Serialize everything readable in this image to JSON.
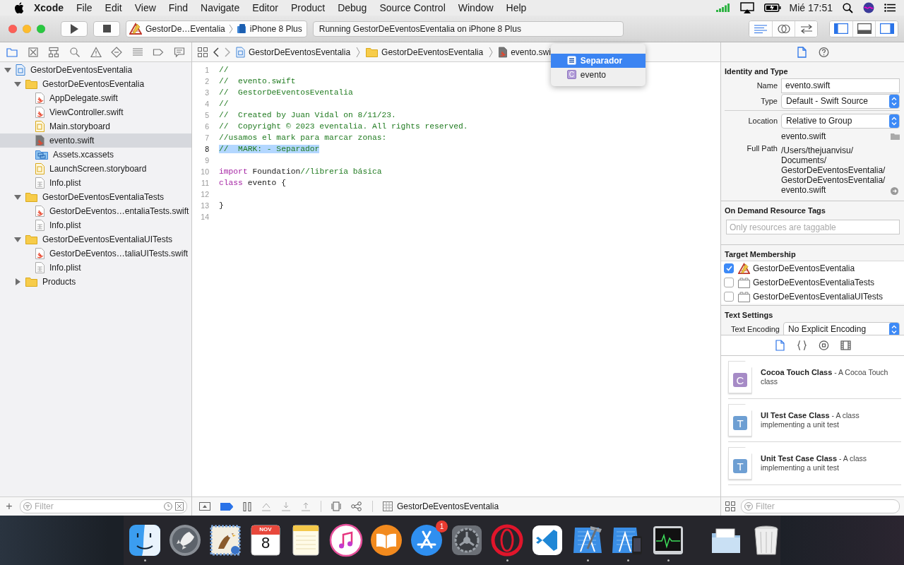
{
  "menu_bar": {
    "app": "Xcode",
    "menus": [
      "File",
      "Edit",
      "View",
      "Find",
      "Navigate",
      "Editor",
      "Product",
      "Debug",
      "Source Control",
      "Window",
      "Help"
    ],
    "clock": "Mié 17:51"
  },
  "toolbar": {
    "scheme": "GestorDe…Eventalia",
    "device": "iPhone 8 Plus",
    "activity": "Running GestorDeEventosEventalia on iPhone 8 Plus",
    "editor_modes": [
      {
        "kind": "standard",
        "selected": true
      },
      {
        "kind": "assistant",
        "selected": false
      },
      {
        "kind": "version",
        "selected": false
      }
    ],
    "panels": [
      {
        "kind": "navigator",
        "on": true
      },
      {
        "kind": "debug",
        "on": false
      },
      {
        "kind": "inspector",
        "on": true
      }
    ]
  },
  "navigator": {
    "tabs": [
      {
        "kind": "project",
        "selected": true
      },
      {
        "kind": "source-control",
        "selected": false
      },
      {
        "kind": "symbol",
        "selected": false
      },
      {
        "kind": "find",
        "selected": false
      },
      {
        "kind": "issue",
        "selected": false
      },
      {
        "kind": "test",
        "selected": false
      },
      {
        "kind": "debug",
        "selected": false
      },
      {
        "kind": "breakpoint",
        "selected": false
      },
      {
        "kind": "report",
        "selected": false
      }
    ],
    "tree": [
      {
        "name": "GestorDeEventosEventalia",
        "kind": "project",
        "expanded": true,
        "selected": false,
        "children": [
          {
            "name": "GestorDeEventosEventalia",
            "kind": "folder",
            "expanded": true,
            "selected": false,
            "children": [
              {
                "name": "AppDelegate.swift",
                "kind": "swift",
                "selected": false
              },
              {
                "name": "ViewController.swift",
                "kind": "swift",
                "selected": false
              },
              {
                "name": "Main.storyboard",
                "kind": "storyboard",
                "selected": false
              },
              {
                "name": "evento.swift",
                "kind": "swift",
                "selected": true
              },
              {
                "name": "Assets.xcassets",
                "kind": "assets",
                "selected": false
              },
              {
                "name": "LaunchScreen.storyboard",
                "kind": "storyboard",
                "selected": false
              },
              {
                "name": "Info.plist",
                "kind": "plist",
                "selected": false
              }
            ]
          },
          {
            "name": "GestorDeEventosEventaliaTests",
            "kind": "folder",
            "expanded": true,
            "selected": false,
            "children": [
              {
                "name": "GestorDeEventos…entaliaTests.swift",
                "kind": "swift",
                "selected": false
              },
              {
                "name": "Info.plist",
                "kind": "plist",
                "selected": false
              }
            ]
          },
          {
            "name": "GestorDeEventosEventaliaUITests",
            "kind": "folder",
            "expanded": true,
            "selected": false,
            "children": [
              {
                "name": "GestorDeEventos…taliaUITests.swift",
                "kind": "swift",
                "selected": false
              },
              {
                "name": "Info.plist",
                "kind": "plist",
                "selected": false
              }
            ]
          },
          {
            "name": "Products",
            "kind": "folder",
            "expanded": false,
            "selected": false
          }
        ]
      }
    ],
    "add_label": "+",
    "filter": {
      "placeholder": "Filter"
    }
  },
  "editor": {
    "crumbs": [
      {
        "kind": "project",
        "text": "GestorDeEventosEventalia"
      },
      {
        "kind": "folder",
        "text": "GestorDeEventosEventalia"
      },
      {
        "kind": "swift",
        "text": "evento.swi"
      }
    ],
    "symbol_menu": [
      {
        "kind": "mark",
        "text": "Separador",
        "selected": true
      },
      {
        "kind": "class",
        "icon_letter": "C",
        "text": "evento",
        "selected": false
      }
    ],
    "lines": [
      {
        "number": "1",
        "highlighted": false,
        "tokens": [
          {
            "kind": "comment",
            "text": "//"
          }
        ]
      },
      {
        "number": "2",
        "highlighted": false,
        "tokens": [
          {
            "kind": "comment",
            "text": "//  evento.swift"
          }
        ]
      },
      {
        "number": "3",
        "highlighted": false,
        "tokens": [
          {
            "kind": "comment",
            "text": "//  GestorDeEventosEventalia"
          }
        ]
      },
      {
        "number": "4",
        "highlighted": false,
        "tokens": [
          {
            "kind": "comment",
            "text": "//"
          }
        ]
      },
      {
        "number": "5",
        "highlighted": false,
        "tokens": [
          {
            "kind": "comment",
            "text": "//  Created by Juan Vidal on 8/11/23."
          }
        ]
      },
      {
        "number": "6",
        "highlighted": false,
        "tokens": [
          {
            "kind": "comment",
            "text": "//  Copyright © 2023 eventalia. All rights reserved."
          }
        ]
      },
      {
        "number": "7",
        "highlighted": false,
        "tokens": [
          {
            "kind": "comment",
            "text": "//usamos el mark para marcar zonas:"
          }
        ]
      },
      {
        "number": "8",
        "highlighted": true,
        "tokens": [
          {
            "kind": "comment",
            "text": "//  MARK: - Separador"
          }
        ]
      },
      {
        "number": "9",
        "highlighted": false
      },
      {
        "number": "10",
        "highlighted": false,
        "tokens": [
          {
            "kind": "keyword",
            "text": "import"
          },
          {
            "kind": "plain",
            "text": " Foundation"
          },
          {
            "kind": "comment",
            "text": "//librería básica"
          }
        ]
      },
      {
        "number": "11",
        "highlighted": false,
        "tokens": [
          {
            "kind": "keyword",
            "text": "class"
          },
          {
            "kind": "plain",
            "text": " evento {"
          }
        ]
      },
      {
        "number": "12",
        "highlighted": false
      },
      {
        "number": "13",
        "highlighted": false,
        "tokens": [
          {
            "kind": "plain",
            "text": "}"
          }
        ]
      },
      {
        "number": "14",
        "highlighted": false
      }
    ],
    "debug_bar": {
      "breakpoints_on": true,
      "scheme": "GestorDeEventosEventalia"
    }
  },
  "inspector": {
    "tabs": [
      {
        "kind": "file",
        "selected": true
      },
      {
        "kind": "help",
        "selected": false
      }
    ],
    "identity": {
      "title": "Identity and Type",
      "name_label": "Name",
      "name": "evento.swift",
      "type_label": "Type",
      "type": "Default - Swift Source",
      "location_label": "Location",
      "location": "Relative to Group",
      "location_file": "evento.swift",
      "full_path_label": "Full Path",
      "full_path_lines": [
        "/Users/thejuanvisu/",
        "Documents/",
        "GestorDeEventosEventalia/",
        "GestorDeEventosEventalia/",
        "evento.swift"
      ]
    },
    "tags": {
      "title": "On Demand Resource Tags",
      "placeholder": "Only resources are taggable"
    },
    "membership": {
      "title": "Target Membership",
      "targets": [
        {
          "name": "GestorDeEventosEventalia",
          "kind": "app",
          "checked": true
        },
        {
          "name": "GestorDeEventosEventaliaTests",
          "kind": "bundle",
          "checked": false
        },
        {
          "name": "GestorDeEventosEventaliaUITests",
          "kind": "bundle",
          "checked": false
        }
      ]
    },
    "text_settings": {
      "title": "Text Settings",
      "encoding_label": "Text Encoding",
      "encoding": "No Explicit Encoding"
    }
  },
  "library": {
    "tabs": [
      {
        "kind": "file",
        "selected": true
      },
      {
        "kind": "snippet",
        "selected": false
      },
      {
        "kind": "object",
        "selected": false
      },
      {
        "kind": "media",
        "selected": false
      }
    ],
    "items": [
      {
        "icon_letter": "C",
        "color": "#a68bc6",
        "title": "Cocoa Touch Class",
        "description": "- A Cocoa Touch class"
      },
      {
        "icon_letter": "T",
        "color": "#6e9fd3",
        "title": "UI Test Case Class",
        "description": "- A class implementing a unit test"
      },
      {
        "icon_letter": "T",
        "color": "#6e9fd3",
        "title": "Unit Test Case Class",
        "description": "- A class implementing a unit test"
      }
    ],
    "filter": {
      "placeholder": "Filter"
    }
  },
  "dock": {
    "apps": [
      {
        "kind": "finder",
        "running": true
      },
      {
        "kind": "launchpad",
        "running": false
      },
      {
        "kind": "mail",
        "running": false
      },
      {
        "kind": "calendar",
        "running": false,
        "month": "NOV",
        "day": "8"
      },
      {
        "kind": "notes",
        "running": false
      },
      {
        "kind": "music",
        "running": false
      },
      {
        "kind": "books",
        "running": false
      },
      {
        "kind": "appstore",
        "running": false,
        "badge": "1"
      },
      {
        "kind": "preferences",
        "running": false
      },
      {
        "kind": "opera",
        "running": true
      },
      {
        "kind": "vscode",
        "running": false
      },
      {
        "kind": "xcode",
        "running": true
      },
      {
        "kind": "simulator",
        "running": true
      },
      {
        "kind": "activity",
        "running": true
      }
    ],
    "others": [
      {
        "kind": "downloads"
      },
      {
        "kind": "trash"
      }
    ]
  }
}
